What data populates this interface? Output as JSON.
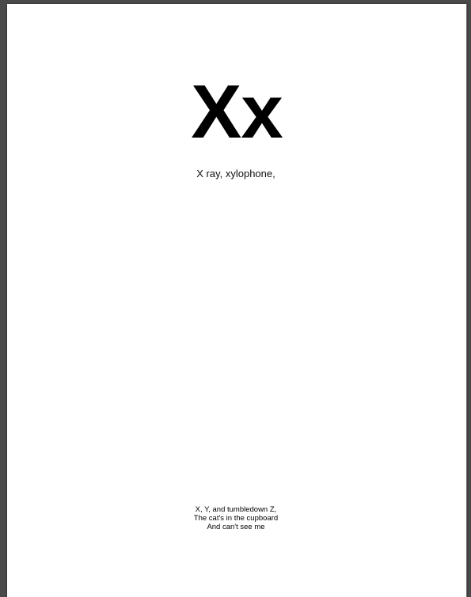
{
  "page": {
    "letters": "Xx",
    "words": "X ray, xylophone,",
    "rhyme": [
      "X, Y, and tumbledown Z,",
      "The cat's in the cupboard",
      "And can't see me"
    ]
  },
  "colors": {
    "viewer_background": "#4a4a4a",
    "page_background": "#ffffff",
    "text": "#000000"
  }
}
